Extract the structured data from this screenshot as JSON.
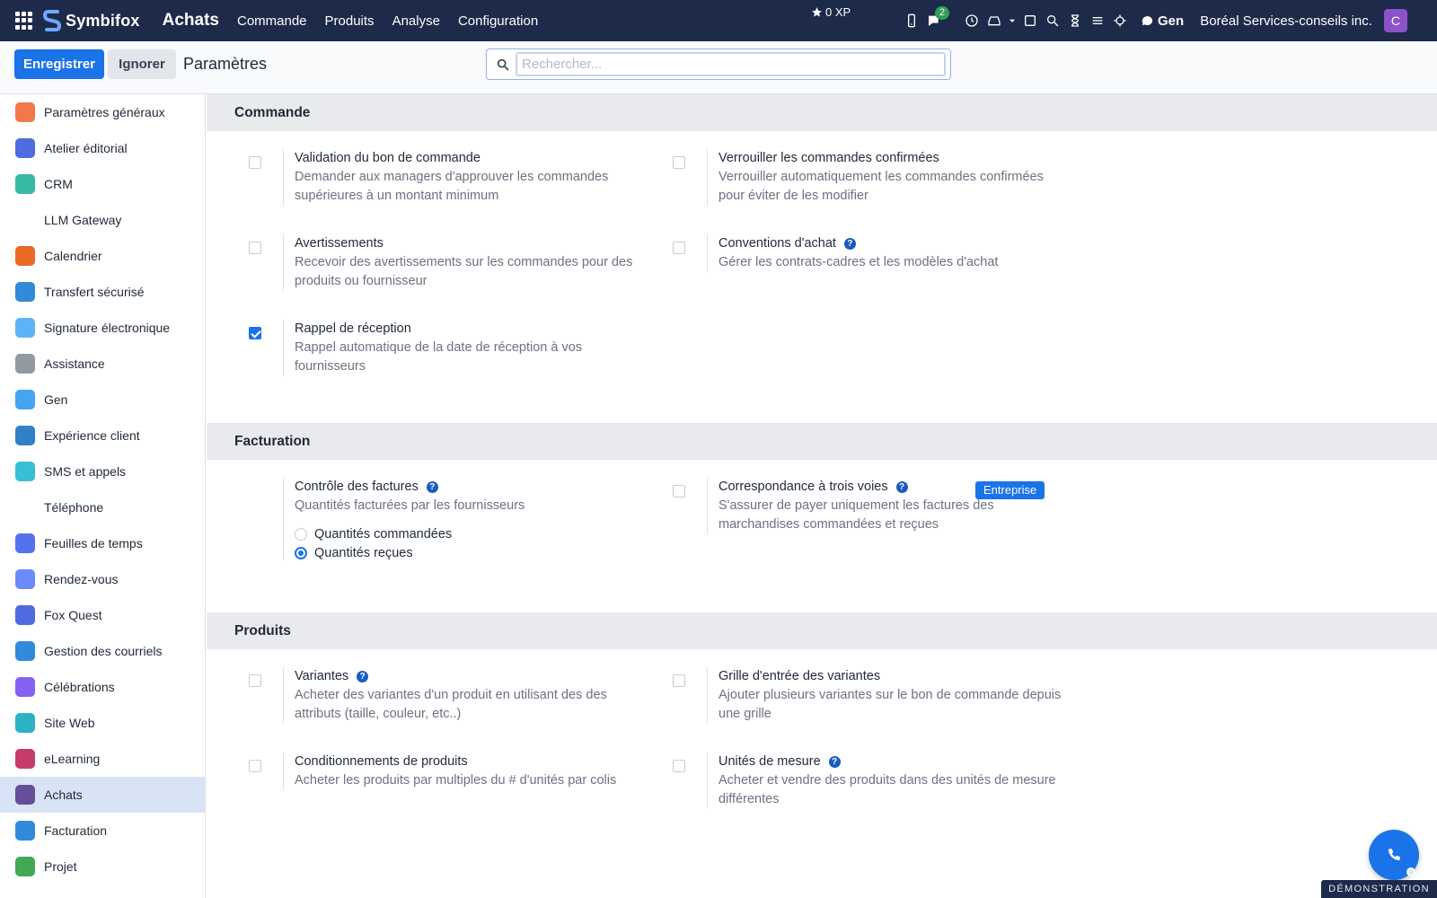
{
  "topbar": {
    "brand_name": "Symbifox",
    "app_title": "Achats",
    "menu": [
      "Commande",
      "Produits",
      "Analyse",
      "Configuration"
    ],
    "xp_label": "0 XP",
    "chat_badge": "2",
    "gen_label": "Gen",
    "company": "Boréal Services-conseils inc.",
    "avatar_initial": "C",
    "colors": {
      "bar": "#1e2a4a",
      "avatar": "#8c52c9",
      "badge": "#2e9e54"
    }
  },
  "controlbar": {
    "save_label": "Enregistrer",
    "discard_label": "Ignorer",
    "page_title": "Paramètres",
    "search_placeholder": "Rechercher..."
  },
  "sidebar": {
    "items": [
      {
        "label": "Paramètres généraux",
        "icon": "settings-hex-icon"
      },
      {
        "label": "Atelier éditorial",
        "icon": "editorial-icon"
      },
      {
        "label": "CRM",
        "icon": "crm-icon"
      },
      {
        "label": "LLM Gateway",
        "icon": "none"
      },
      {
        "label": "Calendrier",
        "icon": "calendar-icon"
      },
      {
        "label": "Transfert sécurisé",
        "icon": "secure-transfer-icon"
      },
      {
        "label": "Signature électronique",
        "icon": "signature-icon"
      },
      {
        "label": "Assistance",
        "icon": "lifebuoy-icon"
      },
      {
        "label": "Gen",
        "icon": "gen-icon"
      },
      {
        "label": "Expérience client",
        "icon": "customer-experience-icon"
      },
      {
        "label": "SMS et appels",
        "icon": "sms-calls-icon"
      },
      {
        "label": "Téléphone",
        "icon": "none"
      },
      {
        "label": "Feuilles de temps",
        "icon": "timesheet-icon"
      },
      {
        "label": "Rendez-vous",
        "icon": "appointment-icon"
      },
      {
        "label": "Fox Quest",
        "icon": "fox-quest-icon"
      },
      {
        "label": "Gestion des courriels",
        "icon": "email-icon"
      },
      {
        "label": "Célébrations",
        "icon": "cake-icon"
      },
      {
        "label": "Site Web",
        "icon": "website-icon"
      },
      {
        "label": "eLearning",
        "icon": "graduation-cap-icon"
      },
      {
        "label": "Achats",
        "icon": "purchase-icon",
        "active": true
      },
      {
        "label": "Facturation",
        "icon": "invoicing-icon"
      },
      {
        "label": "Projet",
        "icon": "project-check-icon"
      }
    ]
  },
  "sections": {
    "commande": {
      "title": "Commande",
      "s1": {
        "title": "Validation du bon de commande",
        "desc": "Demander aux managers d'approuver les commandes supérieures à un montant minimum",
        "checked": false
      },
      "s2": {
        "title": "Verrouiller les commandes confirmées",
        "desc": "Verrouiller automatiquement les commandes confirmées pour éviter de les modifier",
        "checked": false
      },
      "s3": {
        "title": "Avertissements",
        "desc": "Recevoir des avertissements sur les commandes pour des produits ou fournisseur",
        "checked": false
      },
      "s4": {
        "title": "Conventions d'achat",
        "desc": "Gérer les contrats-cadres et les modèles d'achat",
        "checked": false
      },
      "s5": {
        "title": "Rappel de réception",
        "desc": "Rappel automatique de la date de réception à vos fournisseurs",
        "checked": true
      }
    },
    "facturation": {
      "title": "Facturation",
      "s1": {
        "title": "Contrôle des factures",
        "desc": "Quantités facturées par les fournisseurs",
        "options": [
          "Quantités commandées",
          "Quantités reçues"
        ],
        "selected": "Quantités reçues"
      },
      "s2": {
        "title": "Correspondance à trois voies",
        "desc": "S'assurer de payer uniquement les factures des marchandises commandées et reçues",
        "tag": "Entreprise",
        "checked": false
      }
    },
    "produits": {
      "title": "Produits",
      "s1": {
        "title": "Variantes",
        "desc": "Acheter des variantes d'un produit en utilisant des des attributs (taille, couleur, etc..)",
        "checked": false
      },
      "s2": {
        "title": "Grille d'entrée des variantes",
        "desc": "Ajouter plusieurs variantes sur le bon de commande depuis une grille",
        "checked": false
      },
      "s3": {
        "title": "Conditionnements de produits",
        "desc": "Acheter les produits par multiples du # d'unités par colis",
        "checked": false
      },
      "s4": {
        "title": "Unités de mesure",
        "desc": "Acheter et vendre des produits dans des unités de mesure différentes",
        "checked": false
      }
    }
  },
  "footer": {
    "demo_label": "DÉMONSTRATION"
  },
  "accent_color": "#1a73e8"
}
